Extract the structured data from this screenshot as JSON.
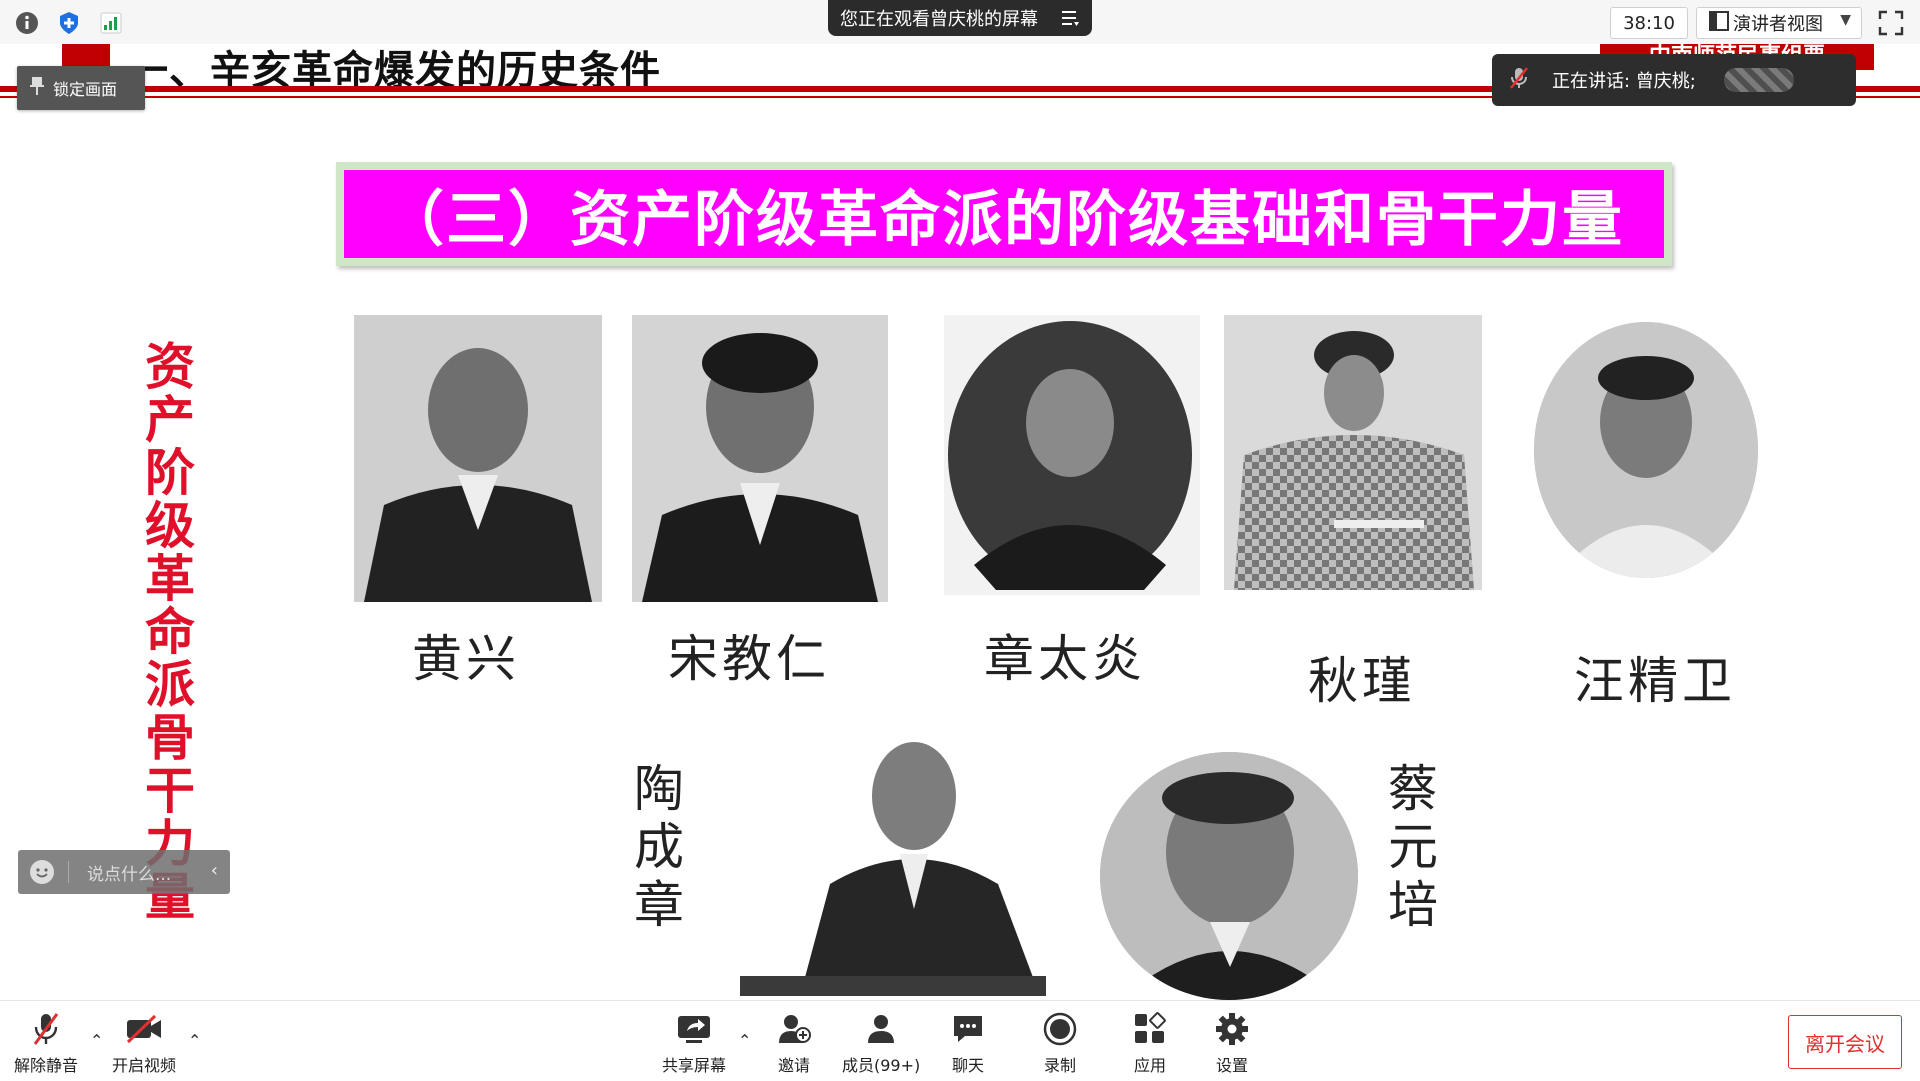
{
  "topbar": {
    "share_banner": "您正在观看曾庆桃的屏幕",
    "timer": "38:10",
    "view_mode": "演讲者视图"
  },
  "overlay": {
    "lock_label": "锁定画面",
    "speaking_label": "正在讲话: 曾庆桃;",
    "chat_placeholder": "说点什么..."
  },
  "slide": {
    "header_text": "一、辛亥革命爆发的历史条件",
    "header_right": "中南师范民事组要",
    "title": "（三）资产阶级革命派的阶级基础和骨干力量",
    "side_title": "资产阶级革命派骨干力量",
    "people": [
      {
        "name": "黄兴"
      },
      {
        "name": "宋教仁"
      },
      {
        "name": "章太炎"
      },
      {
        "name": "秋瑾"
      },
      {
        "name": "汪精卫"
      },
      {
        "name": "陶成章"
      },
      {
        "name": "蔡元培"
      }
    ]
  },
  "toolbar": {
    "unmute": "解除静音",
    "start_video": "开启视频",
    "share_screen": "共享屏幕",
    "invite": "邀请",
    "members": "成员(99+)",
    "chat": "聊天",
    "record": "录制",
    "apps": "应用",
    "settings": "设置",
    "leave": "离开会议"
  },
  "colors": {
    "accent_red": "#c00000",
    "title_magenta": "#ff00ff",
    "title_frame": "#cfe7c7",
    "leave_red": "#e03030"
  }
}
